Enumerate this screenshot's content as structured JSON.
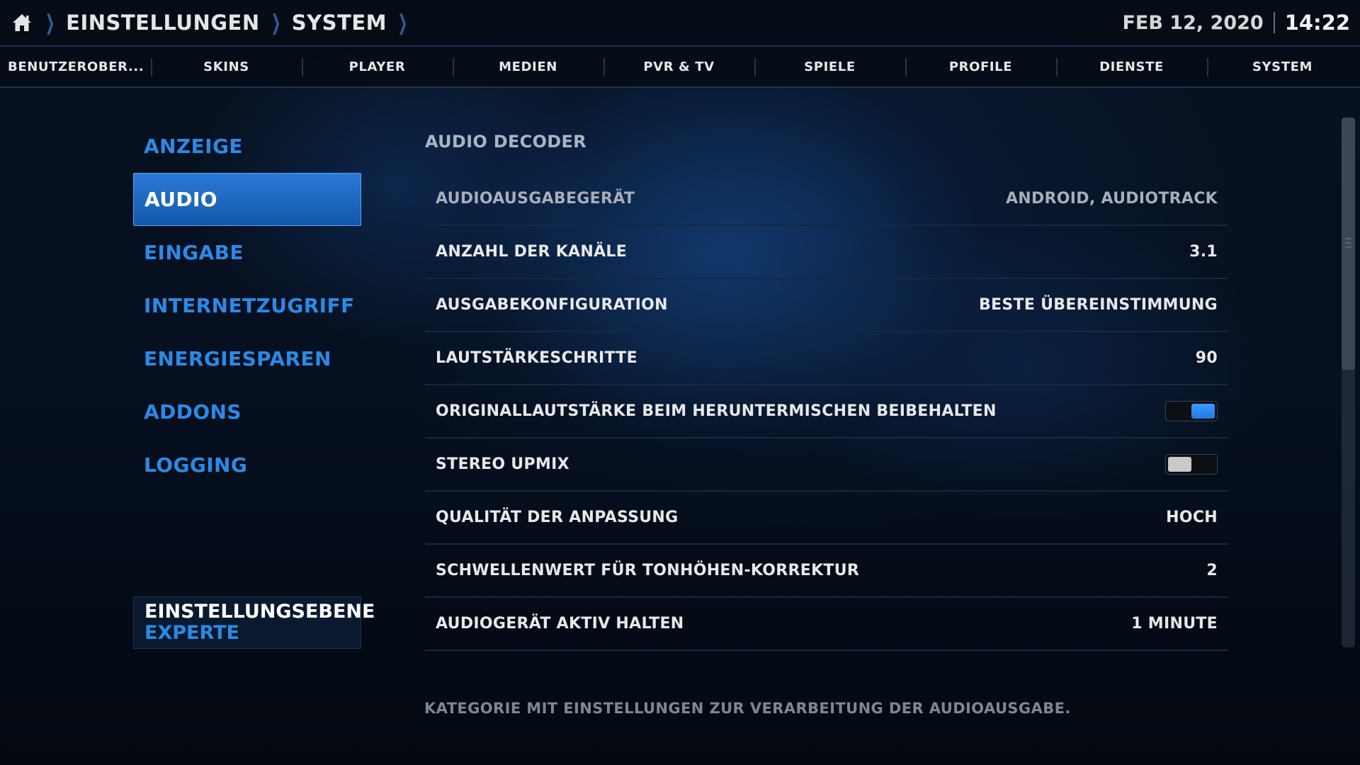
{
  "breadcrumb": {
    "home_icon": "home-icon",
    "items": [
      "EINSTELLUNGEN",
      "SYSTEM"
    ]
  },
  "clock": {
    "date": "FEB 12, 2020",
    "time": "14:22"
  },
  "tabs": [
    {
      "label": "BENUTZEROBER..."
    },
    {
      "label": "SKINS"
    },
    {
      "label": "PLAYER"
    },
    {
      "label": "MEDIEN"
    },
    {
      "label": "PVR & TV"
    },
    {
      "label": "SPIELE"
    },
    {
      "label": "PROFILE"
    },
    {
      "label": "DIENSTE"
    },
    {
      "label": "SYSTEM"
    }
  ],
  "sidebar": {
    "selected": "AUDIO",
    "items": [
      {
        "label": "ANZEIGE"
      },
      {
        "label": "AUDIO"
      },
      {
        "label": "EINGABE"
      },
      {
        "label": "INTERNETZUGRIFF"
      },
      {
        "label": "ENERGIESPAREN"
      },
      {
        "label": "ADDONS"
      },
      {
        "label": "LOGGING"
      }
    ],
    "level": {
      "title": "EINSTELLUNGSEBENE",
      "value": "EXPERTE"
    }
  },
  "main": {
    "section_title": "AUDIO DECODER",
    "settings": [
      {
        "label": "AUDIOAUSGABEGERÄT",
        "value": "ANDROID, AUDIOTRACK"
      },
      {
        "label": "ANZAHL DER KANÄLE",
        "value": "3.1"
      },
      {
        "label": "AUSGABEKONFIGURATION",
        "value": "BESTE ÜBEREINSTIMMUNG"
      },
      {
        "label": "LAUTSTÄRKESCHRITTE",
        "value": "90"
      },
      {
        "label": "ORIGINALLAUTSTÄRKE BEIM HERUNTERMISCHEN BEIBEHALTEN",
        "toggle": true
      },
      {
        "label": "STEREO UPMIX",
        "toggle": false
      },
      {
        "label": "QUALITÄT DER ANPASSUNG",
        "value": "HOCH"
      },
      {
        "label": "SCHWELLENWERT FÜR TONHÖHEN-KORREKTUR",
        "value": "2"
      },
      {
        "label": "AUDIOGERÄT AKTIV HALTEN",
        "value": "1 MINUTE"
      }
    ],
    "description": "KATEGORIE MIT EINSTELLUNGEN ZUR VERARBEITUNG DER AUDIOAUSGABE."
  },
  "colors": {
    "accent": "#2a8ae6",
    "selected_bg": "#1f6dc6",
    "toggle_on": "#2f8cf5"
  }
}
